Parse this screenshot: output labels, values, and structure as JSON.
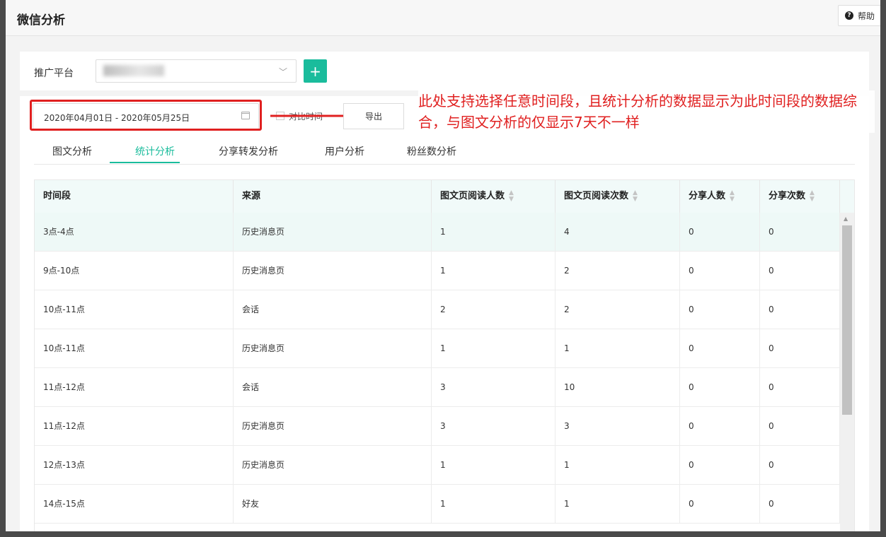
{
  "header": {
    "title": "微信分析",
    "help_label": "帮助"
  },
  "filter": {
    "platform_label": "推广平台",
    "add_label": "+"
  },
  "toolbar": {
    "date_range": "2020年04月01日 - 2020年05月25日",
    "compare_label": "对比时间",
    "export_label": "导出"
  },
  "annotation": "此处支持选择任意时间段，且统计分析的数据显示为此时间段的数据综合，与图文分析的仅显示7天不一样",
  "tabs": [
    "图文分析",
    "统计分析",
    "分享转发分析",
    "用户分析",
    "粉丝数分析"
  ],
  "active_tab": "统计分析",
  "table": {
    "columns": [
      "时间段",
      "来源",
      "图文页阅读人数",
      "图文页阅读次数",
      "分享人数",
      "分享次数"
    ],
    "rows": [
      [
        "3点-4点",
        "历史消息页",
        "1",
        "4",
        "0",
        "0"
      ],
      [
        "9点-10点",
        "历史消息页",
        "1",
        "2",
        "0",
        "0"
      ],
      [
        "10点-11点",
        "会话",
        "2",
        "2",
        "0",
        "0"
      ],
      [
        "10点-11点",
        "历史消息页",
        "1",
        "1",
        "0",
        "0"
      ],
      [
        "11点-12点",
        "会话",
        "3",
        "10",
        "0",
        "0"
      ],
      [
        "11点-12点",
        "历史消息页",
        "3",
        "3",
        "0",
        "0"
      ],
      [
        "12点-13点",
        "历史消息页",
        "1",
        "1",
        "0",
        "0"
      ],
      [
        "14点-15点",
        "好友",
        "1",
        "1",
        "0",
        "0"
      ]
    ]
  },
  "colors": {
    "accent": "#1abc9c",
    "annotation": "#e02020",
    "header_bg": "#f1faf9"
  }
}
